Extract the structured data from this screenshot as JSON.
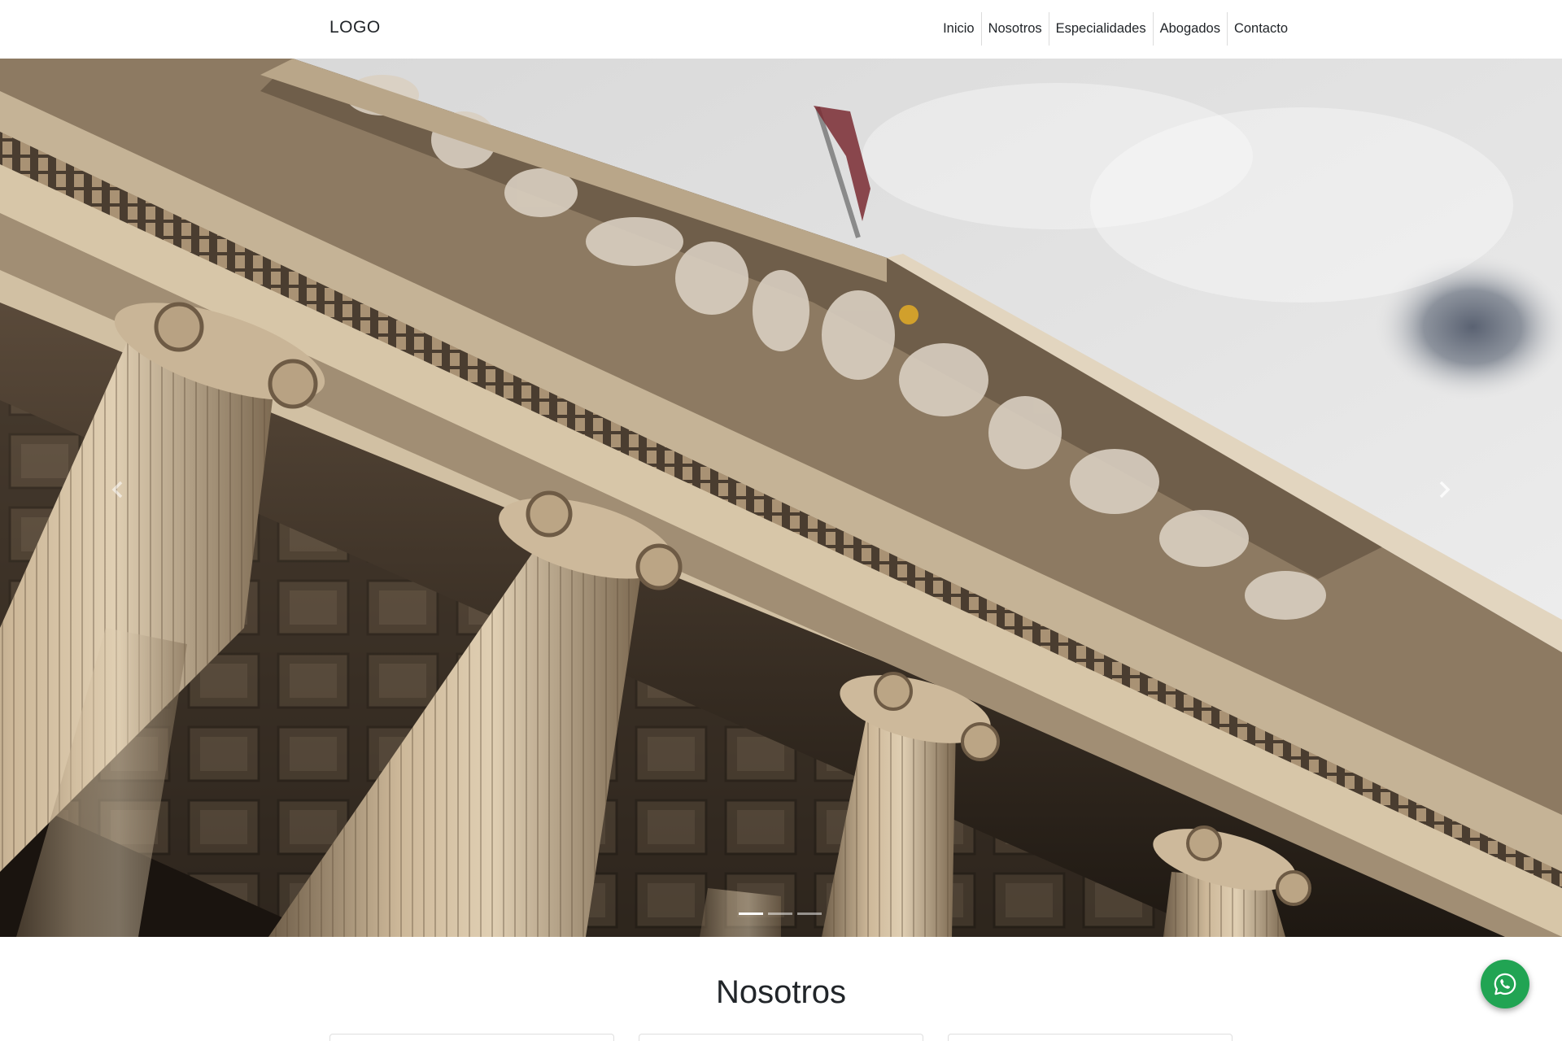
{
  "brand": {
    "logo_text": "LOGO"
  },
  "nav": {
    "items": [
      {
        "label": "Inicio"
      },
      {
        "label": "Nosotros"
      },
      {
        "label": "Especialidades"
      },
      {
        "label": "Abogados"
      },
      {
        "label": "Contacto"
      }
    ]
  },
  "hero": {
    "image": "courthouse-columns-photo",
    "slide_count": 3,
    "active_slide": 1,
    "prev_icon": "chevron-left-icon",
    "next_icon": "chevron-right-icon"
  },
  "about": {
    "title": "Nosotros",
    "card_count": 3
  },
  "whatsapp": {
    "icon": "whatsapp-icon",
    "color": "#21a453"
  }
}
